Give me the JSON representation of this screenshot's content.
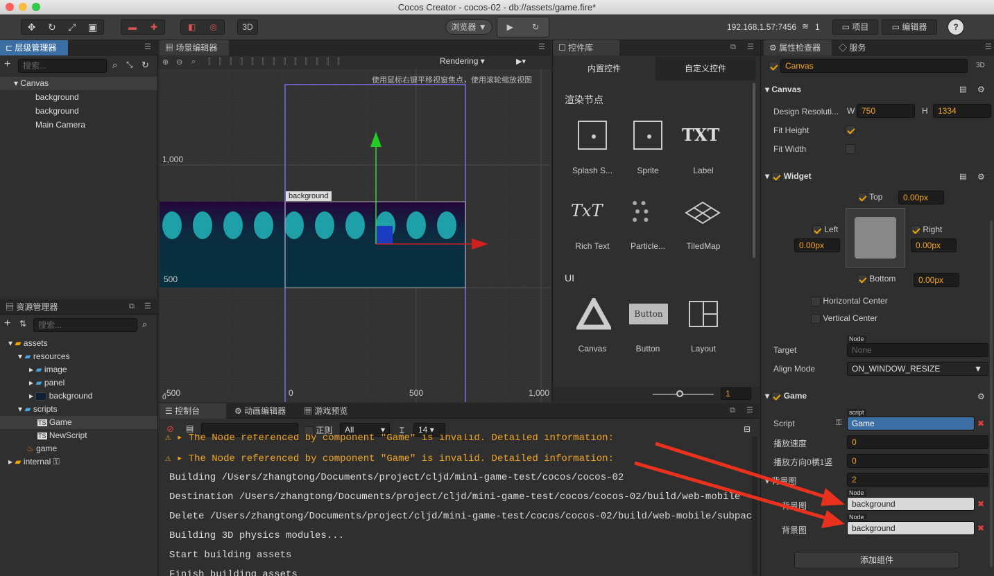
{
  "window": {
    "title": "Cocos Creator - cocos-02 - db://assets/game.fire*"
  },
  "toolbar": {
    "btn_3d": "3D",
    "browser": "浏览器 ▼",
    "ip": "192.168.1.57:7456",
    "wifi_count": "1",
    "project": "项目",
    "editor": "编辑器",
    "help": "?"
  },
  "hierarchy": {
    "tab": "层级管理器",
    "search_placeholder": "搜索...",
    "items": [
      {
        "label": "Canvas"
      },
      {
        "label": "background"
      },
      {
        "label": "background"
      },
      {
        "label": "Main Camera"
      }
    ]
  },
  "assets": {
    "tab": "资源管理器",
    "search_placeholder": "搜索...",
    "items": [
      {
        "label": "assets"
      },
      {
        "label": "resources"
      },
      {
        "label": "image"
      },
      {
        "label": "panel"
      },
      {
        "label": "background"
      },
      {
        "label": "scripts"
      },
      {
        "label": "Game"
      },
      {
        "label": "NewScript"
      },
      {
        "label": "game"
      },
      {
        "label": "internal"
      }
    ]
  },
  "scene": {
    "tab": "场景编辑器",
    "rendering": "Rendering",
    "hint": "使用鼠标右键平移视窗焦点，使用滚轮缩放视图",
    "y_labels": [
      "1,000",
      "500",
      "-500",
      "0"
    ],
    "x_labels": [
      "0",
      "500",
      "1,000"
    ],
    "node_label": "background"
  },
  "widgets": {
    "tab": "控件库",
    "builtin": "内置控件",
    "custom": "自定义控件",
    "render_section": "渲染节点",
    "render_items": [
      {
        "label": "Splash S..."
      },
      {
        "label": "Sprite"
      },
      {
        "label": "Label"
      },
      {
        "label": "Rich Text"
      },
      {
        "label": "Particle..."
      },
      {
        "label": "TiledMap"
      }
    ],
    "ui_section": "UI",
    "ui_items": [
      {
        "label": "Canvas"
      },
      {
        "label": "Button"
      },
      {
        "label": "Layout"
      }
    ],
    "zoom": "1",
    "txt_glyph": "TXT",
    "rich_glyph": "TxT",
    "button_glyph": "Button"
  },
  "console": {
    "tab": "控制台",
    "anim_tab": "动画编辑器",
    "preview_tab": "游戏预览",
    "regex": "正则",
    "filter": "All",
    "font_size": "14",
    "lines": [
      {
        "text": "▸ The Node referenced by component \"Game\" is invalid. Detailed information:"
      },
      {
        "text": "▸ The Node referenced by component \"Game\" is invalid. Detailed information:"
      },
      {
        "text": "Building /Users/zhangtong/Documents/project/cljd/mini-game-test/cocos/cocos-02"
      },
      {
        "text": "Destination /Users/zhangtong/Documents/project/cljd/mini-game-test/cocos/cocos-02/build/web-mobile"
      },
      {
        "text": "Delete /Users/zhangtong/Documents/project/cljd/mini-game-test/cocos/cocos-02/build/web-mobile/subpac"
      },
      {
        "text": "Building 3D physics modules..."
      },
      {
        "text": "Start building assets"
      },
      {
        "text": "Finish building assets"
      }
    ]
  },
  "inspector": {
    "tab": "属性检查器",
    "service_tab": "服务",
    "node_name": "Canvas",
    "mode_3d": "3D",
    "canvas": {
      "title": "Canvas",
      "design_label": "Design Resoluti...",
      "w_label": "W",
      "w": "750",
      "h_label": "H",
      "h": "1334",
      "fit_height": "Fit Height",
      "fit_width": "Fit Width"
    },
    "widget": {
      "title": "Widget",
      "top": "Top",
      "top_val": "0.00px",
      "left": "Left",
      "left_val": "0.00px",
      "right": "Right",
      "right_val": "0.00px",
      "bottom": "Bottom",
      "bottom_val": "0.00px",
      "hcenter": "Horizontal Center",
      "vcenter": "Vertical Center",
      "target_label": "Target",
      "target_tag": "Node",
      "target_val": "None",
      "align_label": "Align Mode",
      "align_val": "ON_WINDOW_RESIZE"
    },
    "game": {
      "title": "Game",
      "script_label": "Script",
      "script_tag": "script",
      "script_val": "Game",
      "speed_label": "播放速度",
      "speed_val": "0",
      "dir_label": "播放方向0横1竖",
      "dir_val": "0",
      "bg_label": "背景图",
      "bg_count": "2",
      "bg_items": [
        {
          "label": "背景图",
          "tag": "Node",
          "val": "background"
        },
        {
          "label": "背景图",
          "tag": "Node",
          "val": "background"
        }
      ]
    },
    "add_component": "添加组件"
  },
  "colors": {
    "accent": "#f0a500",
    "selected_blue": "#3a6ea5",
    "warning": "#f5a623",
    "arrow_red": "#e8321e"
  }
}
